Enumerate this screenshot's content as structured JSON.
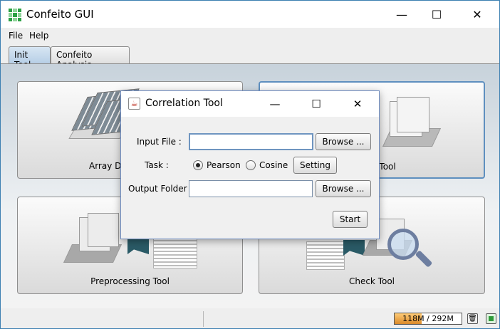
{
  "window": {
    "title": "Confeito GUI",
    "minimize_glyph": "—",
    "maximize_glyph": "☐",
    "close_glyph": "✕"
  },
  "menubar": {
    "items": [
      "File",
      "Help"
    ]
  },
  "tabs": [
    {
      "label": "Init Tool",
      "selected": true
    },
    {
      "label": "Confeito Analysis",
      "selected": false
    }
  ],
  "tools": [
    {
      "label": "Array Da",
      "icon": "microarray-sheets-icon"
    },
    {
      "label": "n Tool",
      "icon": "folder-scatter-icon"
    },
    {
      "label": "Preprocessing Tool",
      "icon": "preprocessing-icon"
    },
    {
      "label": "Check Tool",
      "icon": "magnifier-check-icon"
    }
  ],
  "statusbar": {
    "memory_text": "118M / 292M",
    "memory_used_mb": 118,
    "memory_total_mb": 292,
    "gc_icon": "trash-icon",
    "stop_icon": "stop-icon"
  },
  "dialog": {
    "title": "Correlation Tool",
    "icon": "java-cup-icon",
    "input_file_label": "Input File :",
    "input_file_value": "",
    "browse_label": "Browse ...",
    "task_label": "Task :",
    "task_options": [
      "Pearson",
      "Cosine"
    ],
    "task_selected": "Pearson",
    "setting_label": "Setting",
    "output_folder_label": "Output Folder :",
    "output_folder_value": "",
    "start_label": "Start",
    "accent_color": "#6f95c0"
  }
}
